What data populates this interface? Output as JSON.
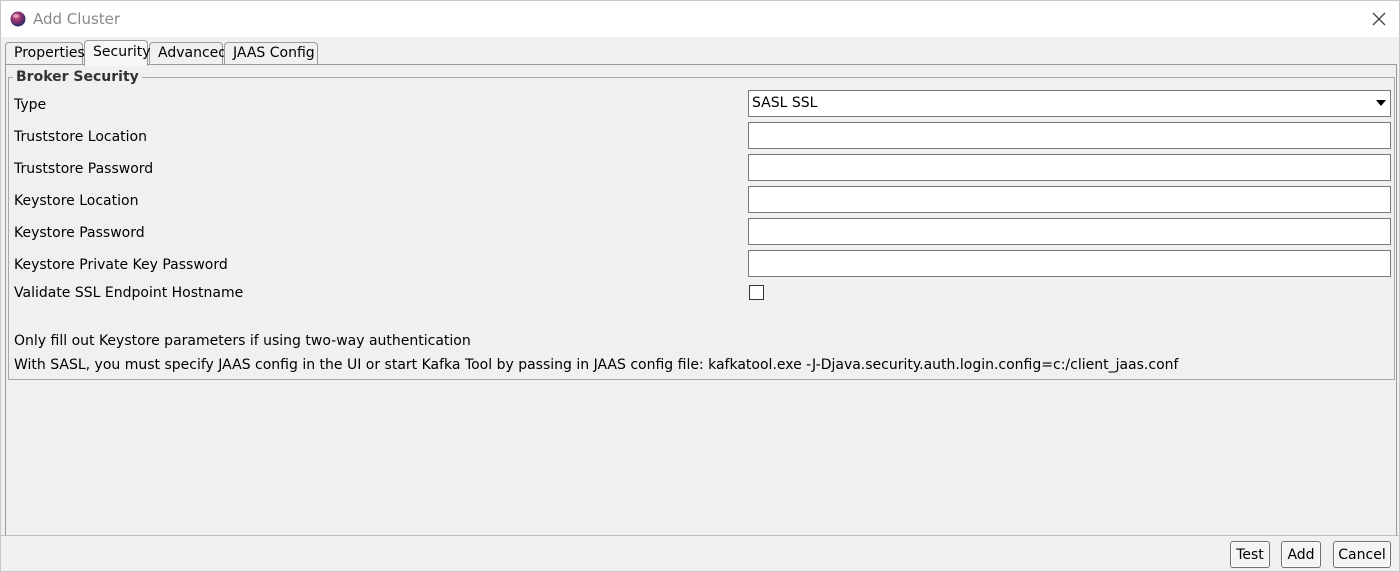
{
  "window": {
    "title": "Add Cluster"
  },
  "tabs": [
    {
      "label": "Properties",
      "active": false
    },
    {
      "label": "Security",
      "active": true
    },
    {
      "label": "Advanced",
      "active": false
    },
    {
      "label": "JAAS Config",
      "active": false
    }
  ],
  "broker_security": {
    "legend": "Broker Security",
    "type": {
      "label": "Type",
      "value": "SASL SSL"
    },
    "truststore_location": {
      "label": "Truststore Location",
      "value": ""
    },
    "truststore_password": {
      "label": "Truststore Password",
      "value": ""
    },
    "keystore_location": {
      "label": "Keystore Location",
      "value": ""
    },
    "keystore_password": {
      "label": "Keystore Password",
      "value": ""
    },
    "keystore_private_key_password": {
      "label": "Keystore Private Key Password",
      "value": ""
    },
    "validate_ssl": {
      "label": "Validate SSL Endpoint Hostname",
      "checked": false
    },
    "notes": [
      "Only fill out Keystore parameters if using two-way authentication",
      "With SASL, you must specify JAAS config in the UI or start Kafka Tool by passing in JAAS config file: kafkatool.exe -J-Djava.security.auth.login.config=c:/client_jaas.conf"
    ]
  },
  "buttons": {
    "test": "Test",
    "add": "Add",
    "cancel": "Cancel"
  }
}
